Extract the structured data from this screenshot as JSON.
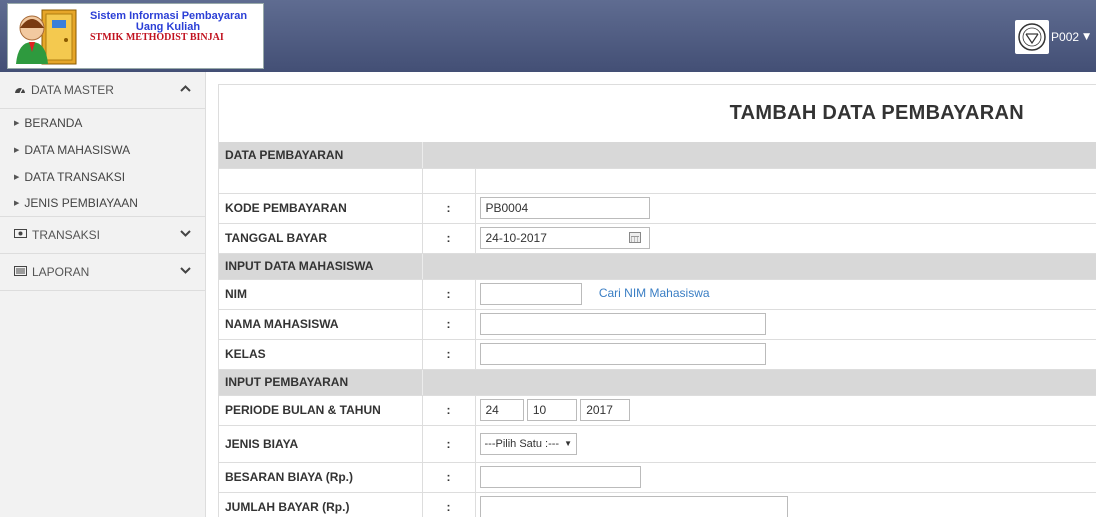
{
  "header": {
    "logo_line1": "Sistem Informasi Pembayaran",
    "logo_line2": "Uang Kuliah",
    "logo_line3": "STMIK METHODIST BINJAI",
    "user": "P002"
  },
  "sidebar": {
    "data_master": "DATA MASTER",
    "items": [
      "BERANDA",
      "DATA MAHASISWA",
      "DATA TRANSAKSI",
      "JENIS PEMBIAYAAN"
    ],
    "transaksi": "TRANSAKSI",
    "laporan": "LAPORAN"
  },
  "page": {
    "title": "TAMBAH DATA PEMBAYARAN"
  },
  "form": {
    "sep": ":",
    "sec_pembayaran": "DATA PEMBAYARAN",
    "kode_label": "KODE PEMBAYARAN",
    "kode_value": "PB0004",
    "tanggal_label": "TANGGAL BAYAR",
    "tanggal_value": "24-10-2017",
    "sec_mahasiswa": "INPUT DATA MAHASISWA",
    "nim_label": "NIM",
    "nim_value": "",
    "cari_link": "Cari NIM Mahasiswa",
    "nama_label": "NAMA MAHASISWA",
    "nama_value": "",
    "kelas_label": "KELAS",
    "kelas_value": "",
    "sec_input": "INPUT PEMBAYARAN",
    "periode_label": "PERIODE BULAN & TAHUN",
    "periode_day": "24",
    "periode_month": "10",
    "periode_year": "2017",
    "jenis_label": "JENIS BIAYA",
    "jenis_value": "---Pilih Satu :---",
    "besaran_label": "BESARAN BIAYA (Rp.)",
    "besaran_value": "",
    "jumlah_label": "JUMLAH BAYAR (Rp.)",
    "jumlah_value": ""
  }
}
